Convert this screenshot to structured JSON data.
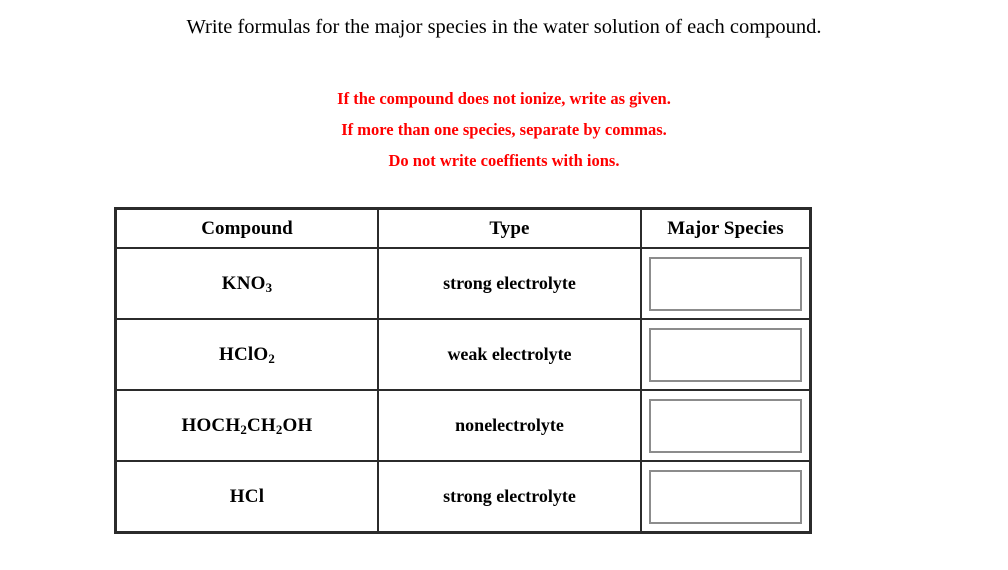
{
  "prompt": {
    "text": "Write formulas for the major species in the water solution of each compound."
  },
  "instructions": {
    "color": "#ff0000",
    "lines": [
      "If the compound does not ionize, write as given.",
      "If more than one species, separate by commas.",
      "Do not write coeffients with ions."
    ]
  },
  "table": {
    "headers": {
      "compound": "Compound",
      "type": "Type",
      "major_species": "Major Species"
    },
    "rows": [
      {
        "compound_base": "KNO",
        "compound_sub": "3",
        "compound_tail": "",
        "compound_plain": "KNO3",
        "type": "strong electrolyte",
        "answer_value": "",
        "answer_placeholder": ""
      },
      {
        "compound_base": "HClO",
        "compound_sub": "2",
        "compound_tail": "",
        "compound_plain": "HClO2",
        "type": "weak electrolyte",
        "answer_value": "",
        "answer_placeholder": ""
      },
      {
        "compound_base": "HOCH",
        "compound_sub": "2",
        "compound_mid": "CH",
        "compound_sub2": "2",
        "compound_tail": "OH",
        "compound_plain": "HOCH2CH2OH",
        "type": "nonelectrolyte",
        "answer_value": "",
        "answer_placeholder": ""
      },
      {
        "compound_base": "HCl",
        "compound_sub": "",
        "compound_tail": "",
        "compound_plain": "HCl",
        "type": "strong electrolyte",
        "answer_value": "",
        "answer_placeholder": ""
      }
    ]
  }
}
